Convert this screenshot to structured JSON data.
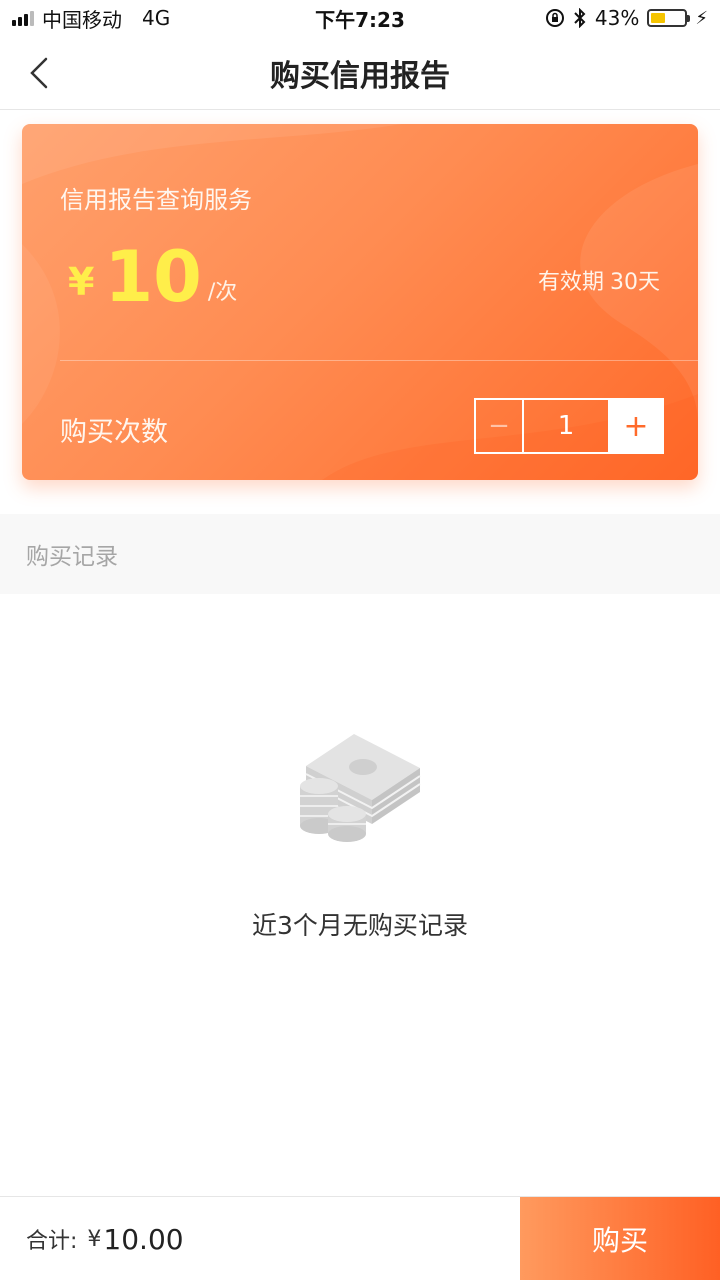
{
  "status_bar": {
    "carrier": "中国移动",
    "network": "4G",
    "time": "下午7:23",
    "battery": "43%",
    "battery_level": 0.43
  },
  "nav": {
    "title": "购买信用报告",
    "back_icon": "chevron-left-icon"
  },
  "card": {
    "title": "信用报告查询服务",
    "currency_symbol": "¥",
    "price": "10",
    "unit": "/次",
    "validity_label": "有效期",
    "validity_value": "30天",
    "quantity_label": "购买次数",
    "quantity": "1",
    "minus_symbol": "−",
    "plus_symbol": "+"
  },
  "records": {
    "header": "购买记录",
    "empty_text": "近3个月无购买记录",
    "empty_icon": "money-stack-icon"
  },
  "footer": {
    "total_label": "合计:",
    "currency_symbol": "¥",
    "total_amount": "10.00",
    "buy_label": "购买"
  },
  "colors": {
    "accent": "#ff7a3c",
    "price": "#ffee4a",
    "muted": "#a6a6a6"
  }
}
